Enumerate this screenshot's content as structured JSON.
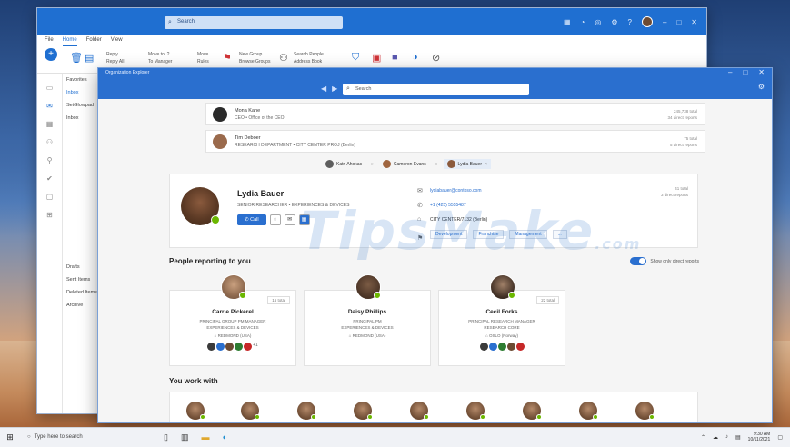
{
  "outlook": {
    "search_placeholder": "Search",
    "menu": [
      "File",
      "Home",
      "Folder",
      "View"
    ],
    "ribbon": {
      "reply": "Reply",
      "reply_all": "Reply All",
      "move_to": "Move to: ?",
      "to_manager": "To Manager",
      "new_group": "New Group",
      "browse_groups": "Browse Groups",
      "search_people": "Search People",
      "address_book": "Address Book",
      "move": "Move",
      "rules": "Rules"
    },
    "folders": [
      "Favorites",
      "Inbox",
      "SetGlowpad",
      "Inbox",
      "Drafts",
      "Sent Items",
      "Deleted Items",
      "Archive"
    ]
  },
  "org_explorer": {
    "title": "Organization Explorer",
    "search_placeholder": "Search",
    "managers": [
      {
        "name": "Mona Kane",
        "title": "CEO • Office of the CEO",
        "reports_total": "245,738 total",
        "reports_direct": "34 direct reports"
      },
      {
        "name": "Tim Deboer",
        "title": "RESEARCH DEPARTMENT • CITY CENTER PROJ (Berlin)",
        "reports_total": "75 total",
        "reports_direct": "5 direct reports"
      }
    ],
    "breadcrumbs": [
      "Katri Ahokas",
      "Cameron Evans",
      "Lydia Bauer"
    ],
    "profile": {
      "name": "Lydia Bauer",
      "title": "SENIOR RESEARCHER • EXPERIENCES & DEVICES",
      "call_label": "Call",
      "email": "lydiabauer@contoso.com",
      "phone": "+1 (425) 5555487",
      "location": "CITY CENTER/7132 (Berlin)",
      "tags": [
        "Development",
        "Franchise",
        "Management",
        "..."
      ],
      "reports_total": "41 total",
      "reports_direct": "3 direct reports"
    },
    "section_reports": "People reporting to you",
    "toggle_label": "Show only direct reports",
    "reports": [
      {
        "name": "Carrie Pickerel",
        "title": "PRINCIPAL GROUP PM MANAGER",
        "dept": "EXPERIENCES & DEVICES",
        "location": "REDMOND (USA)",
        "badge": "16 total",
        "more": "+1"
      },
      {
        "name": "Daisy Phillips",
        "title": "PRINCIPAL PM",
        "dept": "EXPERIENCES & DEVICES",
        "location": "REDMOND (USA)",
        "badge": "",
        "more": ""
      },
      {
        "name": "Cecil Forks",
        "title": "PRINCIPAL RESEARCH MANAGER",
        "dept": "RESEARCH CORE",
        "location": "OSLO (Norway)",
        "badge": "22 total",
        "more": ""
      }
    ],
    "section_work": "You work with"
  },
  "watermark": "TipsMake",
  "watermark_suffix": ".com",
  "taskbar": {
    "search_placeholder": "Type here to search",
    "time": "9:30 AM",
    "date": "10/11/2021"
  }
}
